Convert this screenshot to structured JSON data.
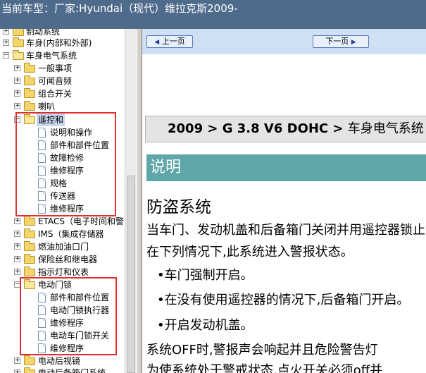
{
  "window": {
    "title": "当前车型：厂家:Hyundai（现代）维拉克斯2009-"
  },
  "tree": {
    "items": [
      {
        "label": "制动系统"
      },
      {
        "label": "车身(内部和外部)"
      },
      {
        "label": "车身电气系统"
      },
      {
        "label": "一般事项"
      },
      {
        "label": "可闻音频"
      },
      {
        "label": "组合开关"
      },
      {
        "label": "喇叭"
      },
      {
        "label": "遥控和"
      },
      {
        "label": "说明和操作"
      },
      {
        "label": "部件和部件位置"
      },
      {
        "label": "故障检修"
      },
      {
        "label": "维修程序"
      },
      {
        "label": "规格"
      },
      {
        "label": "传送器"
      },
      {
        "label": "维修程序"
      },
      {
        "label": "ETACS（电子时间和警"
      },
      {
        "label": "IMS（集成存储器"
      },
      {
        "label": "燃油加油口门"
      },
      {
        "label": "保险丝和继电器"
      },
      {
        "label": "指示灯和仪表"
      },
      {
        "label": "电动门锁"
      },
      {
        "label": "部件和部件位置"
      },
      {
        "label": "电动门锁执行器"
      },
      {
        "label": "维修程序"
      },
      {
        "label": "电动车门锁开关"
      },
      {
        "label": "维修程序"
      },
      {
        "label": "电动后视镜"
      },
      {
        "label": "电动后备箱门系统"
      }
    ]
  },
  "nav": {
    "prev_label": "上一页",
    "next_label": "下一页"
  },
  "document": {
    "header_main": "2009 > G 3.8 V6 DOHC > ",
    "header_cat": "车身电气系统",
    "section_title": "说明",
    "subtitle": "防盗系统",
    "paragraph1": "当车门、发动机盖和后备箱门关闭并用遥控器锁止时，",
    "paragraph2": "在下列情况下,此系统进入警报状态。",
    "bullet1": "•车门强制开启。",
    "bullet2": "•在没有使用遥控器的情况下,后备箱门开启。",
    "bullet3": "•开启发动机盖。",
    "paragraph3": "系统OFF时,警报声会响起并且危险警告灯",
    "paragraph4": "为使系统处于警戒状态,点火开关必须off并"
  }
}
